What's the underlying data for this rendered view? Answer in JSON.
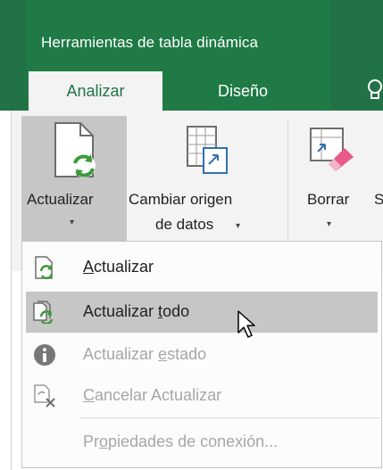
{
  "context_group": {
    "title": "Herramientas de tabla dinámica"
  },
  "tabs": [
    {
      "label": "Analizar",
      "active": true
    },
    {
      "label": "Diseño",
      "active": false
    }
  ],
  "ribbon": {
    "actualizar": {
      "label": "Actualizar",
      "caret": "▾"
    },
    "cambiar_origen": {
      "line1": "Cambiar origen",
      "line2": "de datos",
      "caret": "▾"
    },
    "borrar": {
      "label": "Borrar",
      "caret": "▾"
    },
    "cut_label": "S"
  },
  "menu": {
    "items": [
      {
        "pre": "",
        "u": "A",
        "post": "ctualizar",
        "icon": "refresh-icon",
        "state": "normal"
      },
      {
        "pre": "Actualizar ",
        "u": "t",
        "post": "odo",
        "icon": "refresh-all-icon",
        "state": "hover"
      },
      {
        "pre": "Actualizar ",
        "u": "e",
        "post": "stado",
        "icon": "info-icon",
        "state": "disabled"
      },
      {
        "pre": "",
        "u": "C",
        "post": "ancelar Actualizar",
        "icon": "cancel-refresh-icon",
        "state": "disabled"
      },
      {
        "pre": "Pr",
        "u": "o",
        "post": "piedades de conexión...",
        "icon": "",
        "state": "disabled"
      }
    ]
  },
  "colors": {
    "ribbon_green": "#217346",
    "refresh_green": "#3a9a3a",
    "menu_hover": "#c6c6c6"
  }
}
